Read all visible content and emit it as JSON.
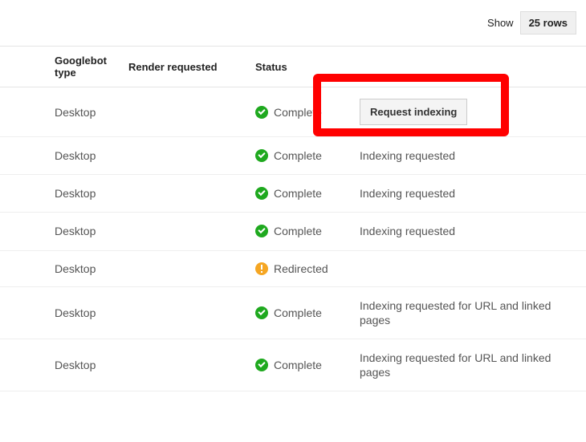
{
  "topbar": {
    "show_label": "Show",
    "rows_value": "25 rows"
  },
  "headers": {
    "type": "Googlebot type",
    "render": "Render requested",
    "status": "Status"
  },
  "buttons": {
    "request_indexing": "Request indexing"
  },
  "rows": [
    {
      "type": "Desktop",
      "render": "",
      "status_icon": "check",
      "status": "Complete",
      "action_kind": "button"
    },
    {
      "type": "Desktop",
      "render": "",
      "status_icon": "check",
      "status": "Complete",
      "action_kind": "text",
      "action_text": "Indexing requested"
    },
    {
      "type": "Desktop",
      "render": "",
      "status_icon": "check",
      "status": "Complete",
      "action_kind": "text",
      "action_text": "Indexing requested"
    },
    {
      "type": "Desktop",
      "render": "",
      "status_icon": "check",
      "status": "Complete",
      "action_kind": "text",
      "action_text": "Indexing requested"
    },
    {
      "type": "Desktop",
      "render": "",
      "status_icon": "warn",
      "status": "Redirected",
      "action_kind": "none"
    },
    {
      "type": "Desktop",
      "render": "",
      "status_icon": "check",
      "status": "Complete",
      "action_kind": "text",
      "action_text": "Indexing requested for URL and linked pages"
    },
    {
      "type": "Desktop",
      "render": "",
      "status_icon": "check",
      "status": "Complete",
      "action_kind": "text",
      "action_text": "Indexing requested for URL and linked pages"
    }
  ]
}
